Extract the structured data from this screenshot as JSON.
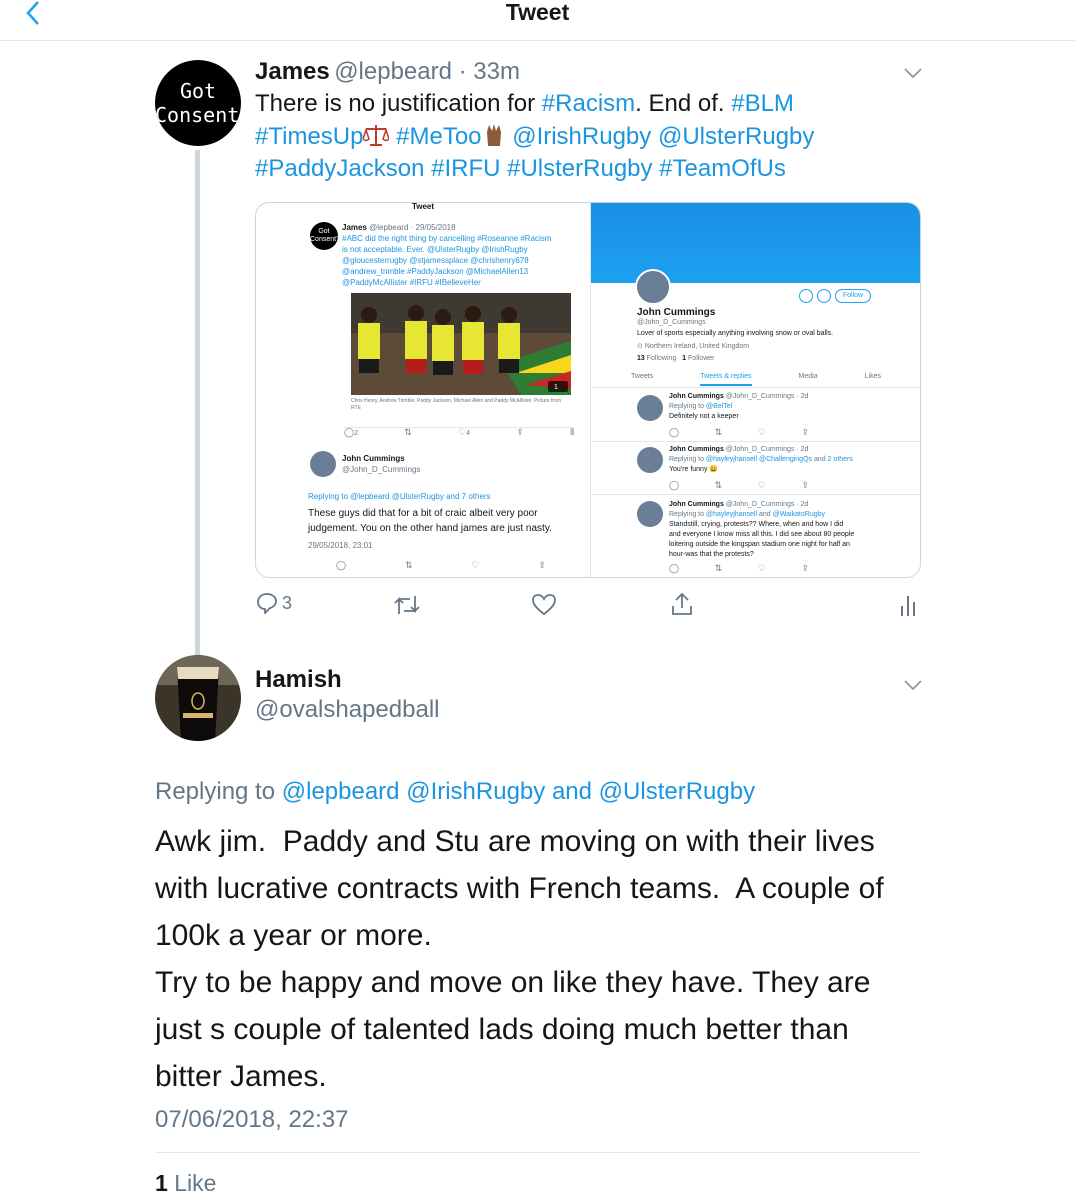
{
  "header": {
    "title": "Tweet"
  },
  "tweet": {
    "avatar_text_line1": "Got",
    "avatar_text_line2": "Consent?",
    "name": "James",
    "handle": "@lepbeard",
    "time": "33m",
    "line1_pre": "There is no justification for ",
    "line1_tag1": "#Racism",
    "line1_mid": ". End of. ",
    "line1_tag2": "#BLM",
    "line2_tag1": "#TimesUp",
    "line2_tag2": "#MeToo",
    "line2_tag3": "@IrishRugby",
    "line2_tag4": "@UlsterRugby",
    "line3": "#PaddyJackson #IRFU #UlsterRugby #TeamOfUs",
    "reply_count": "3"
  },
  "embed": {
    "left": {
      "title": "Tweet",
      "avatar_l1": "Got",
      "avatar_l2": "Consent?",
      "name": "James",
      "handle_time": "@lepbeard · 29/05/2018",
      "text_l1": "#ABC did the right thing by cancelling #Roseanne #Racism",
      "text_l2": "is not acceptable. Ever. @UlsterRugby @IrishRugby",
      "text_l3": "@gloucesterrugby @stjamessplace @chrishenry678",
      "text_l4": "@andrew_trimble #PaddyJackson @MichaelAllen13",
      "text_l5": "@PaddyMcAllister #IRFU #IBelieveHer",
      "photo_badge": "1",
      "caption": "Chris Henry, Andrew Trimble, Paddy Jackson, Michael Allen and Paddy McAllister. Picture from RTE",
      "reply_count": "2",
      "like_count": "4",
      "reply_name": "John Cummings",
      "reply_handle": "@John_D_Cummings",
      "replying_to": "Replying to @lepbeard @UlsterRugby and 7 others",
      "reply_l1": "These guys did that for a bit of craic albeit very poor",
      "reply_l2": "judgement. You on the other hand james are just nasty.",
      "reply_time": "29/05/2018, 23:01"
    },
    "right": {
      "follow": "Follow",
      "name": "John Cummings",
      "handle": "@John_D_Cummings",
      "bio": "Lover of sports especially anything involving snow or oval balls.",
      "location": "Northern Ireland, United Kingdom",
      "following_num": "13",
      "following_label": "Following",
      "followers_num": "1",
      "followers_label": "Follower",
      "tabs": [
        "Tweets",
        "Tweets & replies",
        "Media",
        "Likes"
      ],
      "tweets": [
        {
          "name": "John Cummings",
          "meta": "@John_D_Cummings · 2d",
          "replying": "Replying to @BelTel",
          "text": [
            "Definitely not a keeper"
          ]
        },
        {
          "name": "John Cummings",
          "meta": "@John_D_Cummings · 2d",
          "replying": "Replying to @hayleyjhansell @ChallengingQs and 2 others",
          "text": [
            "You're funny 😀"
          ]
        },
        {
          "name": "John Cummings",
          "meta": "@John_D_Cummings · 2d",
          "replying": "Replying to @hayleyjhansell and @WaikatoRugby",
          "text": [
            "Standstill, crying, protests?? Where, when and how I did",
            "and everyone I know miss all this. I did see about 80 people",
            "loitering outside the kingspan stadium one night for half an",
            "hour-was that the protests?"
          ]
        }
      ]
    }
  },
  "reply": {
    "name": "Hamish",
    "handle": "@ovalshapedball",
    "replying_label": "Replying to ",
    "replying_h1": "@lepbeard",
    "replying_h2": "@IrishRugby",
    "replying_and": " and ",
    "replying_h3": "@UlsterRugby",
    "text_l1": "Awk jim.  Paddy and Stu are moving on with their lives",
    "text_l2": "with lucrative contracts with French teams.  A couple of",
    "text_l3": "100k a year or more.",
    "text_l4": "Try to be happy and move on like they have. They are",
    "text_l5": "just s couple of talented lads doing much better than",
    "text_l6": "bitter James.",
    "timestamp": "07/06/2018, 22:37",
    "like_count": "1",
    "like_label": "Like"
  },
  "colors": {
    "link": "#1b95e0",
    "secondary": "#657786",
    "border": "#e1e8ed",
    "profile_banner": "#1da1f2"
  }
}
